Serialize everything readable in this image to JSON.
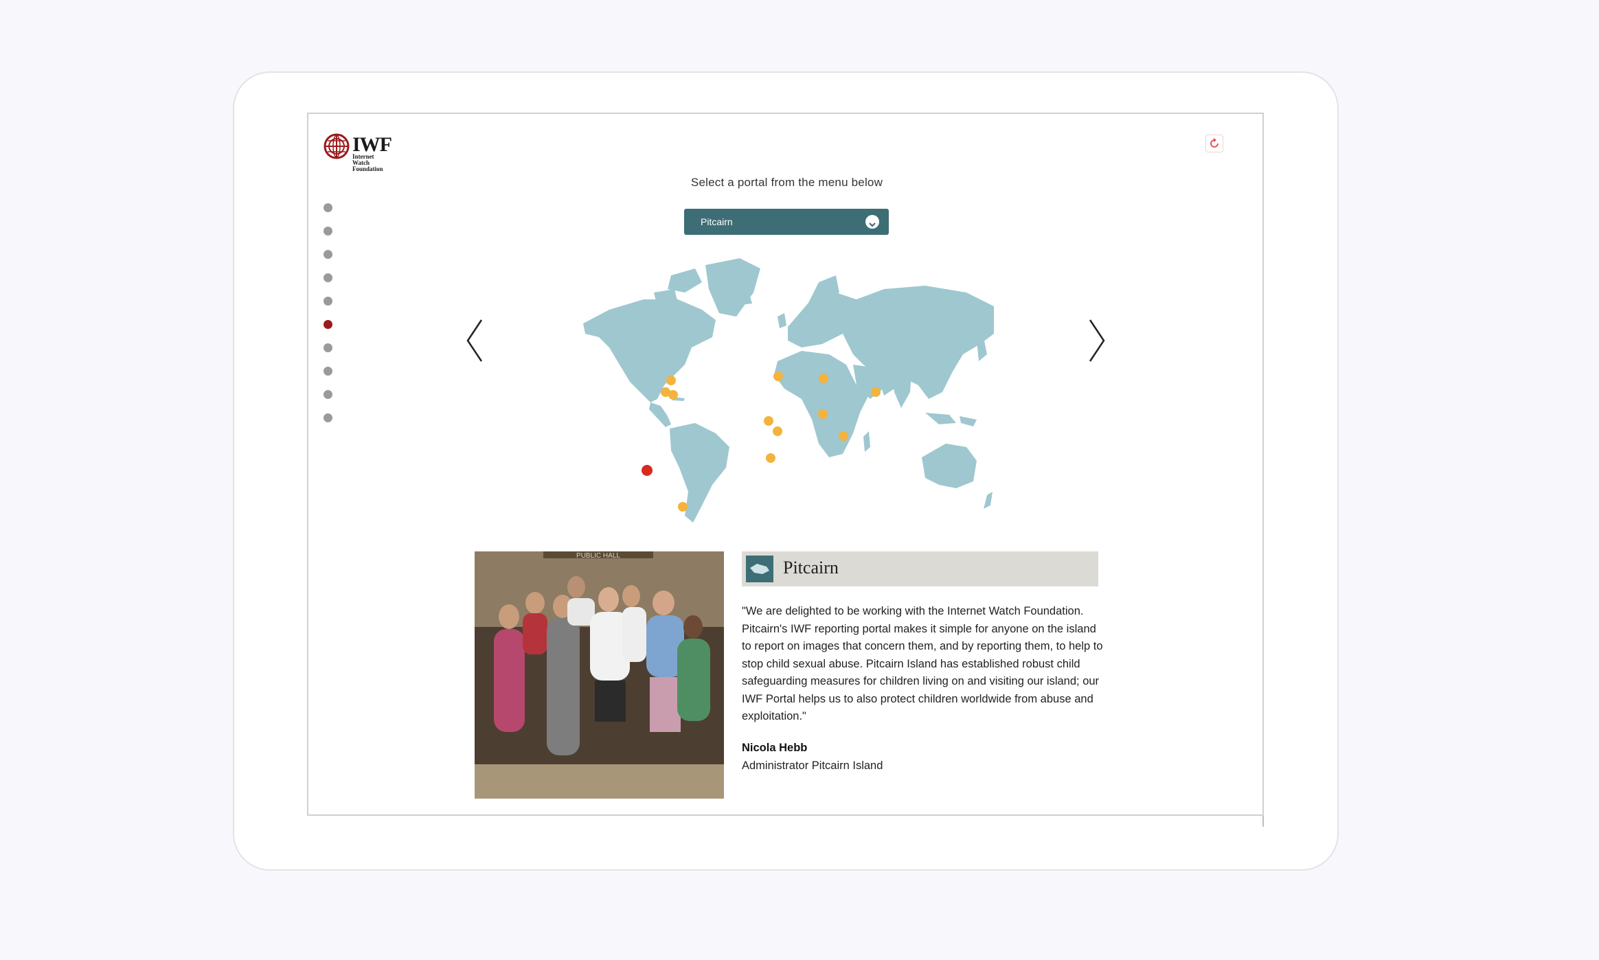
{
  "logo": {
    "word": "IWF",
    "sub_lines": [
      "Internet",
      "Watch",
      "Foundation"
    ]
  },
  "header": {
    "prompt": "Select a portal from the menu below",
    "selected_portal": "Pitcairn",
    "dropdown_icon": "chevron-down-icon",
    "refresh_icon": "refresh-icon"
  },
  "nav": {
    "dot_count": 10,
    "active_index": 5
  },
  "carousel": {
    "prev_icon": "chevron-left-icon",
    "next_icon": "chevron-right-icon"
  },
  "map": {
    "land_color": "#9fc7d0",
    "marker_color": "#f3b33d",
    "selected_marker_color": "#d92a20"
  },
  "portal": {
    "name": "Pitcairn",
    "flag_icon": "pitcairn-island-icon",
    "quote": "\"We are delighted to be working with the Internet Watch Foundation. Pitcairn's IWF reporting portal makes it simple for anyone on the island to report on images that concern them, and by reporting them, to help to stop child sexual abuse. Pitcairn Island has established robust child safeguarding measures for children living on and visiting our island; our IWF Portal helps us to also protect children worldwide from abuse and exploitation.\"",
    "author_name": "Nicola Hebb",
    "author_role": "Administrator Pitcairn Island",
    "photo_sign": "PUBLIC HALL"
  },
  "colors": {
    "accent": "#3d6d75",
    "brand_red": "#9b1a1a",
    "title_bar": "#dcdad5"
  }
}
